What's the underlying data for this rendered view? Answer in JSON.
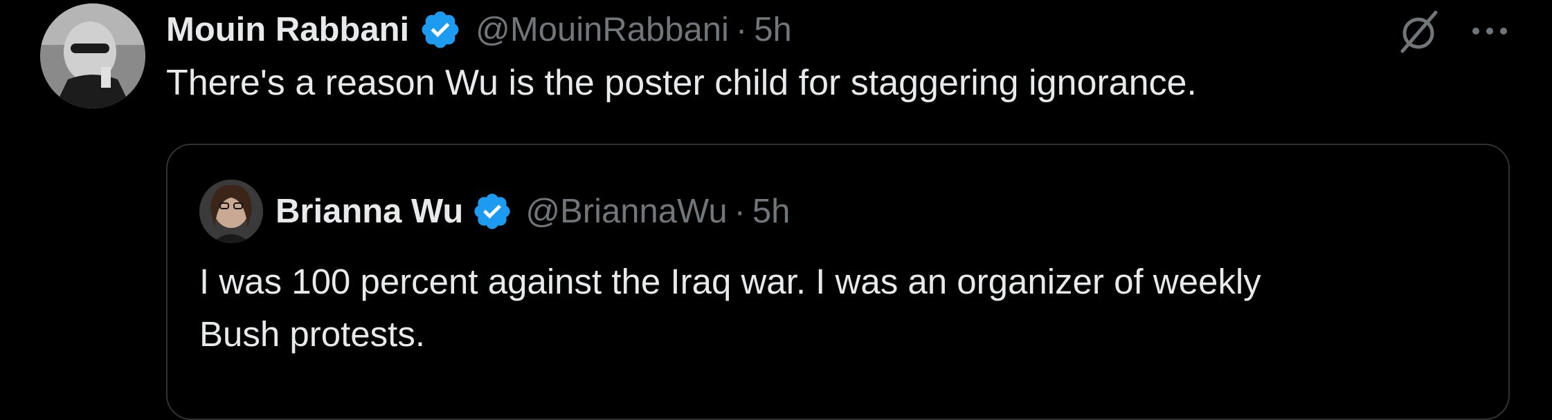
{
  "tweet": {
    "author": {
      "display_name": "Mouin Rabbani",
      "handle": "@MouinRabbani",
      "verified": true
    },
    "separator": "·",
    "time": "5h",
    "text": "There's a reason Wu is the poster child for staggering ignorance.",
    "actions": {
      "grok_icon": "grok-slash-icon",
      "more_icon": "more-horizontal-icon"
    }
  },
  "quoted_tweet": {
    "author": {
      "display_name": "Brianna Wu",
      "handle": "@BriannaWu",
      "verified": true
    },
    "separator": "·",
    "time": "5h",
    "text_line1": "I was 100 percent against the Iraq war. I was an organizer of weekly",
    "text_line2": "Bush protests."
  },
  "colors": {
    "background": "#000000",
    "primary_text": "#e7e9ea",
    "secondary_text": "#71767b",
    "verified_blue": "#1d9bf0",
    "border": "#2f3336"
  }
}
